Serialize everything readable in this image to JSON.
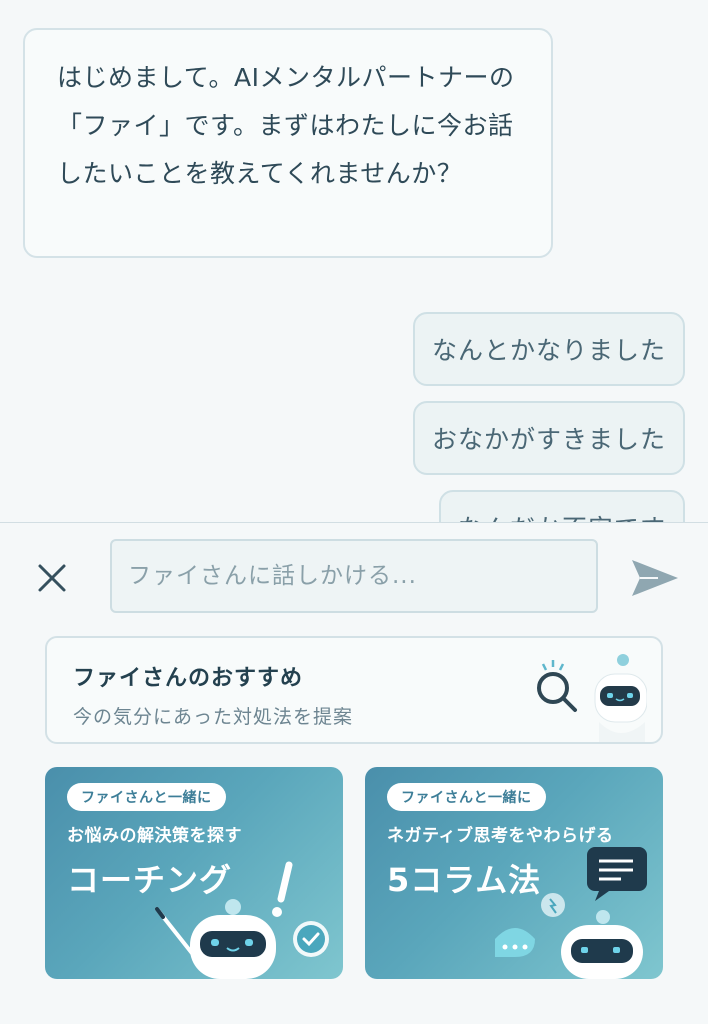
{
  "chat": {
    "ai_message": "はじめまして。AIメンタルパートナーの「ファイ」です。まずはわたしに今お話したいことを教えてくれませんか？",
    "user_messages": [
      "なんとかなりました",
      "おなかがすきました",
      "なんだか不安です"
    ]
  },
  "input": {
    "placeholder": "ファイさんに話しかける..."
  },
  "recommend": {
    "title": "ファイさんのおすすめ",
    "subtitle": "今の気分にあった対処法を提案"
  },
  "promos": [
    {
      "tag": "ファイさんと一緒に",
      "subtitle": "お悩みの解決策を探す",
      "title": "コーチング"
    },
    {
      "tag": "ファイさんと一緒に",
      "subtitle": "ネガティブ思考をやわらげる",
      "title": "5コラム法"
    }
  ],
  "icons": {
    "close": "close-icon",
    "send": "send-icon"
  },
  "colors": {
    "send": "#8fa7b1",
    "close": "#35505e",
    "card_gradient_start": "#4a8fab",
    "card_gradient_end": "#7fc6cf"
  }
}
